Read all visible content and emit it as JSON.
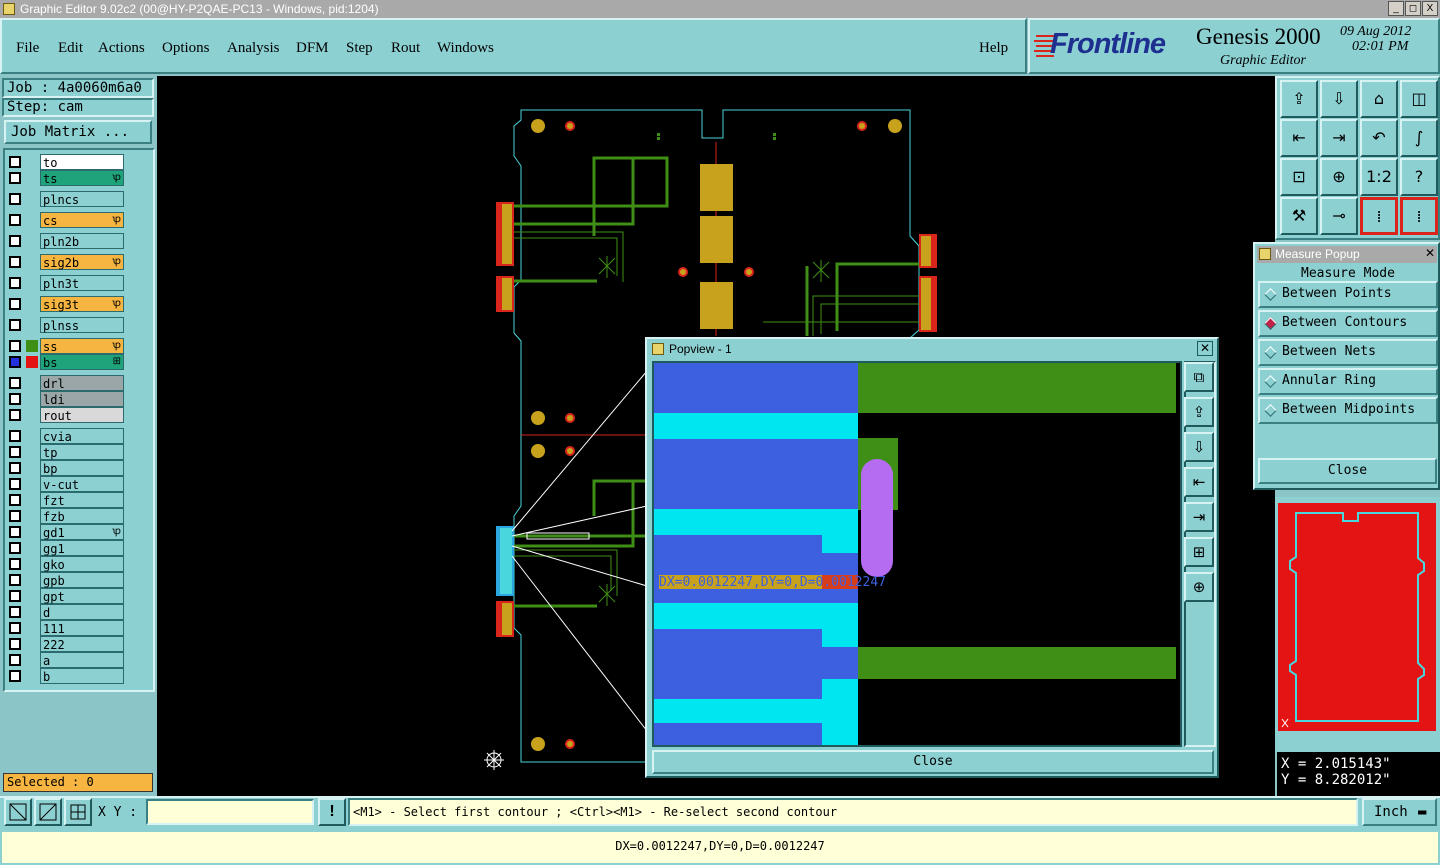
{
  "window": {
    "title": "Graphic Editor 9.02c2 (00@HY-P2QAE-PC13 - Windows, pid:1204)",
    "min": "_",
    "max": "◻",
    "close": "X"
  },
  "menu": {
    "file": "File",
    "edit": "Edit",
    "actions": "Actions",
    "options": "Options",
    "analysis": "Analysis",
    "dfm": "DFM",
    "step": "Step",
    "rout": "Rout",
    "windows": "Windows",
    "help": "Help"
  },
  "brand": {
    "logo": "Frontline",
    "product": "Genesis 2000",
    "subtitle": "Graphic Editor",
    "date": "09 Aug 2012",
    "time": "02:01 PM"
  },
  "job": {
    "job": "Job : 4a0060m6a0",
    "step": "Step: cam",
    "matrix_button": "Job Matrix ..."
  },
  "layers": [
    {
      "name": "to",
      "color": "#ffffff"
    },
    {
      "name": "ts",
      "color": "#1fa37a",
      "mark": "ꝕ"
    },
    {
      "name": "plncs",
      "color": "#8cd0d2"
    },
    {
      "name": "cs",
      "color": "#f5b540",
      "mark": "ꝕ"
    },
    {
      "name": "pln2b",
      "color": "#8cd0d2"
    },
    {
      "name": "sig2b",
      "color": "#f5b540",
      "mark": "ꝕ"
    },
    {
      "name": "pln3t",
      "color": "#8cd0d2"
    },
    {
      "name": "sig3t",
      "color": "#f5b540",
      "mark": "ꝕ"
    },
    {
      "name": "plnss",
      "color": "#8cd0d2"
    },
    {
      "name": "ss",
      "color": "#f5b540",
      "mark": "ꝕ"
    },
    {
      "name": "bs",
      "color": "#1fa37a",
      "mark": "⊞"
    },
    {
      "name": "drl",
      "color": "#9aa6a8"
    },
    {
      "name": "ldi",
      "color": "#9aa6a8"
    },
    {
      "name": "rout",
      "color": "#d9d9d9"
    },
    {
      "name": "cvia",
      "color": "#8cd0d2"
    },
    {
      "name": "tp",
      "color": "#8cd0d2"
    },
    {
      "name": "bp",
      "color": "#8cd0d2"
    },
    {
      "name": "v-cut",
      "color": "#8cd0d2"
    },
    {
      "name": "fzt",
      "color": "#8cd0d2"
    },
    {
      "name": "fzb",
      "color": "#8cd0d2"
    },
    {
      "name": "gd1",
      "color": "#8cd0d2",
      "mark": "ꝕ"
    },
    {
      "name": "gg1",
      "color": "#8cd0d2"
    },
    {
      "name": "gko",
      "color": "#8cd0d2"
    },
    {
      "name": "gpb",
      "color": "#8cd0d2"
    },
    {
      "name": "gpt",
      "color": "#8cd0d2"
    },
    {
      "name": "d",
      "color": "#8cd0d2"
    },
    {
      "name": "111",
      "color": "#8cd0d2"
    },
    {
      "name": "222",
      "color": "#8cd0d2"
    },
    {
      "name": "a",
      "color": "#8cd0d2"
    },
    {
      "name": "b",
      "color": "#8cd0d2"
    }
  ],
  "selected": "Selected : 0",
  "popview": {
    "title": "Popview - 1",
    "measure": "DX=0.0012247,DY=0,D=0.0012247",
    "close": "Close"
  },
  "measure": {
    "title": "Measure Popup",
    "mode": "Measure Mode",
    "options": [
      "Between Points",
      "Between Contours",
      "Between Nets",
      "Annular Ring",
      "Between Midpoints"
    ],
    "selected_option": "Between Contours",
    "close": "Close"
  },
  "coords": {
    "x": "X = 2.015143\"",
    "y": "Y = 8.282012\""
  },
  "bottom": {
    "xy_label": "X Y :",
    "xy_value": "",
    "hint": "<M1> - Select first contour ; <Ctrl><M1> - Re-select second contour",
    "units": "Inch",
    "status": "DX=0.0012247,DY=0,D=0.0012247"
  },
  "toolbar_icons": [
    "zoom-home",
    "zoom-in-icon",
    "zoom-out-icon",
    "home-icon",
    "window-icon",
    "pan-left-icon",
    "pan-right-icon",
    "undo-icon",
    "step-icon",
    "fit-icon",
    "center-icon",
    "scale-icon",
    "help-icon",
    "tools-icon",
    "measure-icon",
    "net-icon",
    "drill-icon"
  ]
}
